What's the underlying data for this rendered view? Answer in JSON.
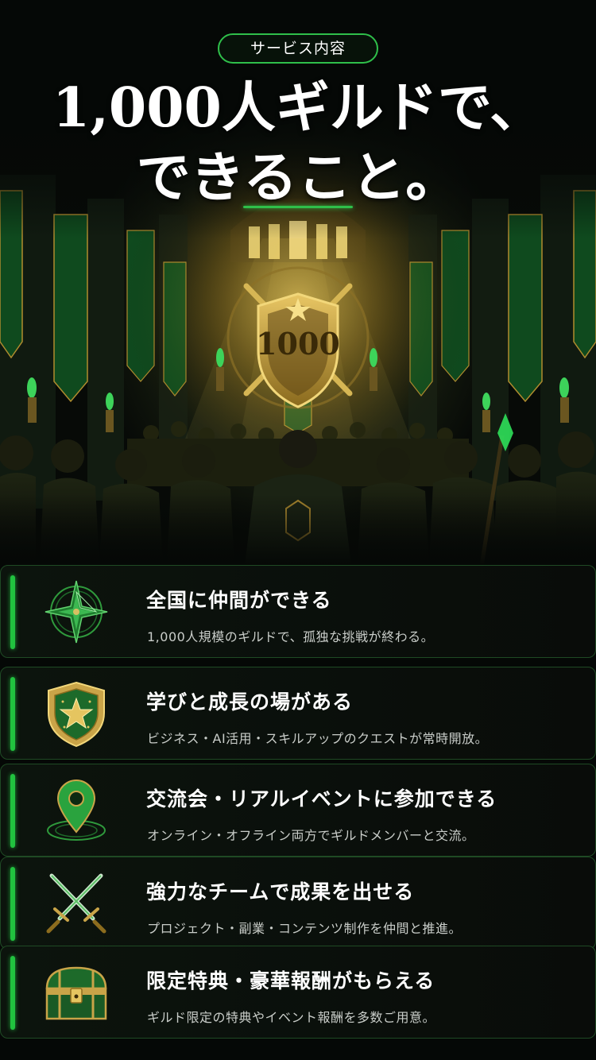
{
  "header": {
    "badge": "サービス内容",
    "title_line1": "1,000人ギルドで、",
    "title_line2": "できること。"
  },
  "hero": {
    "emblem_number": "1000"
  },
  "features": [
    {
      "icon": "compass-star-icon",
      "title": "全国に仲間ができる",
      "description": "1,000人規模のギルドで、孤独な挑戦が終わる。"
    },
    {
      "icon": "star-shield-icon",
      "title": "学びと成長の場がある",
      "description": "ビジネス・AI活用・スキルアップのクエストが常時開放。"
    },
    {
      "icon": "map-pin-icon",
      "title": "交流会・リアルイベントに参加できる",
      "description": "オンライン・オフライン両方でギルドメンバーと交流。"
    },
    {
      "icon": "crossed-swords-icon",
      "title": "強力なチームで成果を出せる",
      "description": "プロジェクト・副業・コンテンツ制作を仲間と推進。"
    },
    {
      "icon": "treasure-chest-icon",
      "title": "限定特典・豪華報酬がもらえる",
      "description": "ギルド限定の特典やイベント報酬を多数ご用意。"
    }
  ],
  "colors": {
    "accent_green": "#21c23f",
    "gold": "#d9b24a",
    "background": "#050806"
  }
}
